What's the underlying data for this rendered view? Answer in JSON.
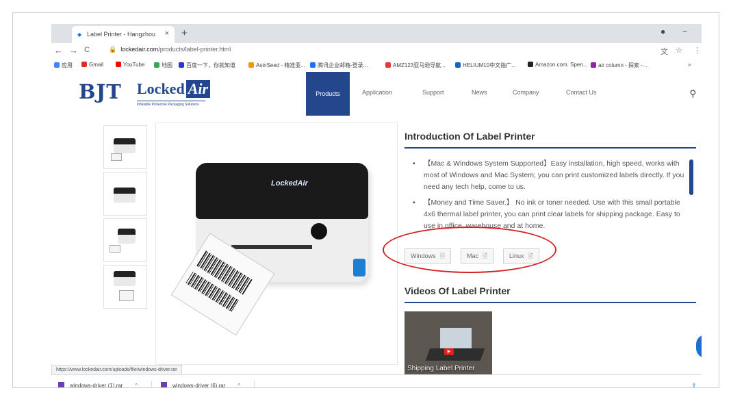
{
  "browser": {
    "tab_title": "Label Printer - Hangzhou Bing Ji...",
    "tab_close": "×",
    "new_tab": "+",
    "url_host": "lockedair.com",
    "url_path": "/products/label-printer.html",
    "nav_back": "←",
    "nav_forward": "→",
    "nav_reload": "C",
    "lock": "🔒"
  },
  "bookmarks": [
    {
      "label": "应用",
      "color": "#4285f4"
    },
    {
      "label": "Gmail",
      "color": "#d93025"
    },
    {
      "label": "YouTube",
      "color": "#ff0000"
    },
    {
      "label": "地图",
      "color": "#34a853"
    },
    {
      "label": "百度一下，你就知道",
      "color": "#2932e1"
    },
    {
      "label": "AsinSeed - 精准亚...",
      "color": "#f29900"
    },
    {
      "label": "腾讯企业邮箱-登录...",
      "color": "#1a73e8"
    },
    {
      "label": "AMZ123亚马逊导航...",
      "color": "#e53935"
    },
    {
      "label": "HELIUM10中文指广...",
      "color": "#1565c0"
    },
    {
      "label": "Amazon.com. Spen...",
      "color": "#222222"
    },
    {
      "label": "air column - 探索 -...",
      "color": "#8e24aa"
    }
  ],
  "site": {
    "logo_bjt": "BJT",
    "logo_locked": "Locked",
    "logo_air": "Air",
    "logo_tagline": "Inflatable Protective Packaging Solutions",
    "menu": [
      "Products",
      "Application",
      "Support",
      "News",
      "Company",
      "Contact Us"
    ],
    "active_menu": "Products"
  },
  "product": {
    "printer_brand": "LockedAir"
  },
  "intro": {
    "title": "Introduction Of Label Printer",
    "bullets": [
      "【Mac & Windows System Supported】Easy installation, high speed, works with most of Windows and Mac System; you can print customized labels directly. If you need any tech help, come to us.",
      "【Money and Time Saver.】 No ink or toner needed. Use with this small portable 4x6 thermal label printer, you can print clear labels for shipping package. Easy to use in office, warehouse and at home."
    ],
    "buttons": [
      "Windows",
      "Mac",
      "Linux"
    ]
  },
  "videos": {
    "title": "Videos Of Label Printer",
    "caption": "Shipping Label Printer"
  },
  "status_url": "https://www.lockedair.com/uploads/file/windows-driver.rar",
  "downloads": [
    {
      "name": "windows-driver (1).rar"
    },
    {
      "name": "windows-driver (6).rar"
    }
  ],
  "colors": {
    "brand_blue": "#23468c",
    "highlight_red": "#d32020"
  }
}
